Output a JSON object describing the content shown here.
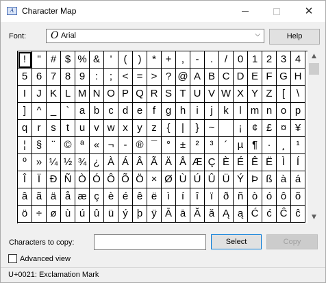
{
  "window": {
    "title": "Character Map",
    "app_icon": "character-map-icon",
    "app_icon_glyph": "A",
    "minimize_icon": "minimize-icon",
    "maximize_icon": "maximize-icon",
    "close_icon": "close-icon",
    "close_glyph": "✕"
  },
  "font": {
    "label": "Font:",
    "type_glyph": "O",
    "value": "Arial",
    "chevron": "⌵",
    "help_label": "Help"
  },
  "grid": {
    "columns": 20,
    "selected_index": 0,
    "chars": [
      "!",
      "\"",
      "#",
      "$",
      "%",
      "&",
      "'",
      "(",
      ")",
      "*",
      "+",
      ",",
      "-",
      ".",
      "/",
      "0",
      "1",
      "2",
      "3",
      "4",
      "5",
      "6",
      "7",
      "8",
      "9",
      ":",
      ";",
      "<",
      "=",
      ">",
      "?",
      "@",
      "A",
      "B",
      "C",
      "D",
      "E",
      "F",
      "G",
      "H",
      "I",
      "J",
      "K",
      "L",
      "M",
      "N",
      "O",
      "P",
      "Q",
      "R",
      "S",
      "T",
      "U",
      "V",
      "W",
      "X",
      "Y",
      "Z",
      "[",
      "\\",
      "]",
      "^",
      "_",
      "`",
      "a",
      "b",
      "c",
      "d",
      "e",
      "f",
      "g",
      "h",
      "i",
      "j",
      "k",
      "l",
      "m",
      "n",
      "o",
      "p",
      "q",
      "r",
      "s",
      "t",
      "u",
      "v",
      "w",
      "x",
      "y",
      "z",
      "{",
      "|",
      "}",
      "~",
      " ",
      "¡",
      "¢",
      "£",
      "¤",
      "¥",
      "¦",
      "§",
      "¨",
      "©",
      "ª",
      "«",
      "¬",
      "-",
      "®",
      "¯",
      "°",
      "±",
      "²",
      "³",
      "´",
      "µ",
      "¶",
      "·",
      "¸",
      "¹",
      "º",
      "»",
      "¼",
      "½",
      "¾",
      "¿",
      "À",
      "Á",
      "Â",
      "Ã",
      "Ä",
      "Å",
      "Æ",
      "Ç",
      "È",
      "É",
      "Ê",
      "Ë",
      "Ì",
      "Í",
      "Î",
      "Ï",
      "Ð",
      "Ñ",
      "Ò",
      "Ó",
      "Ô",
      "Õ",
      "Ö",
      "×",
      "Ø",
      "Ù",
      "Ú",
      "Û",
      "Ü",
      "Ý",
      "Þ",
      "ß",
      "à",
      "á",
      "â",
      "ã",
      "ä",
      "å",
      "æ",
      "ç",
      "è",
      "é",
      "ê",
      "ë",
      "ì",
      "í",
      "î",
      "ï",
      "ð",
      "ñ",
      "ò",
      "ó",
      "ô",
      "õ",
      "ö",
      "÷",
      "ø",
      "ù",
      "ú",
      "û",
      "ü",
      "ý",
      "þ",
      "ÿ",
      "Ā",
      "ā",
      "Ă",
      "ă",
      "Ą",
      "ą",
      "Ć",
      "ć",
      "Ĉ",
      "ĉ"
    ],
    "scroll_up_glyph": "▲",
    "scroll_down_glyph": "▼"
  },
  "copy": {
    "label": "Characters to copy:",
    "value": "",
    "select_label": "Select",
    "copy_label": "Copy"
  },
  "advanced": {
    "label": "Advanced view",
    "checked": false
  },
  "status": {
    "text": "U+0021: Exclamation Mark"
  }
}
